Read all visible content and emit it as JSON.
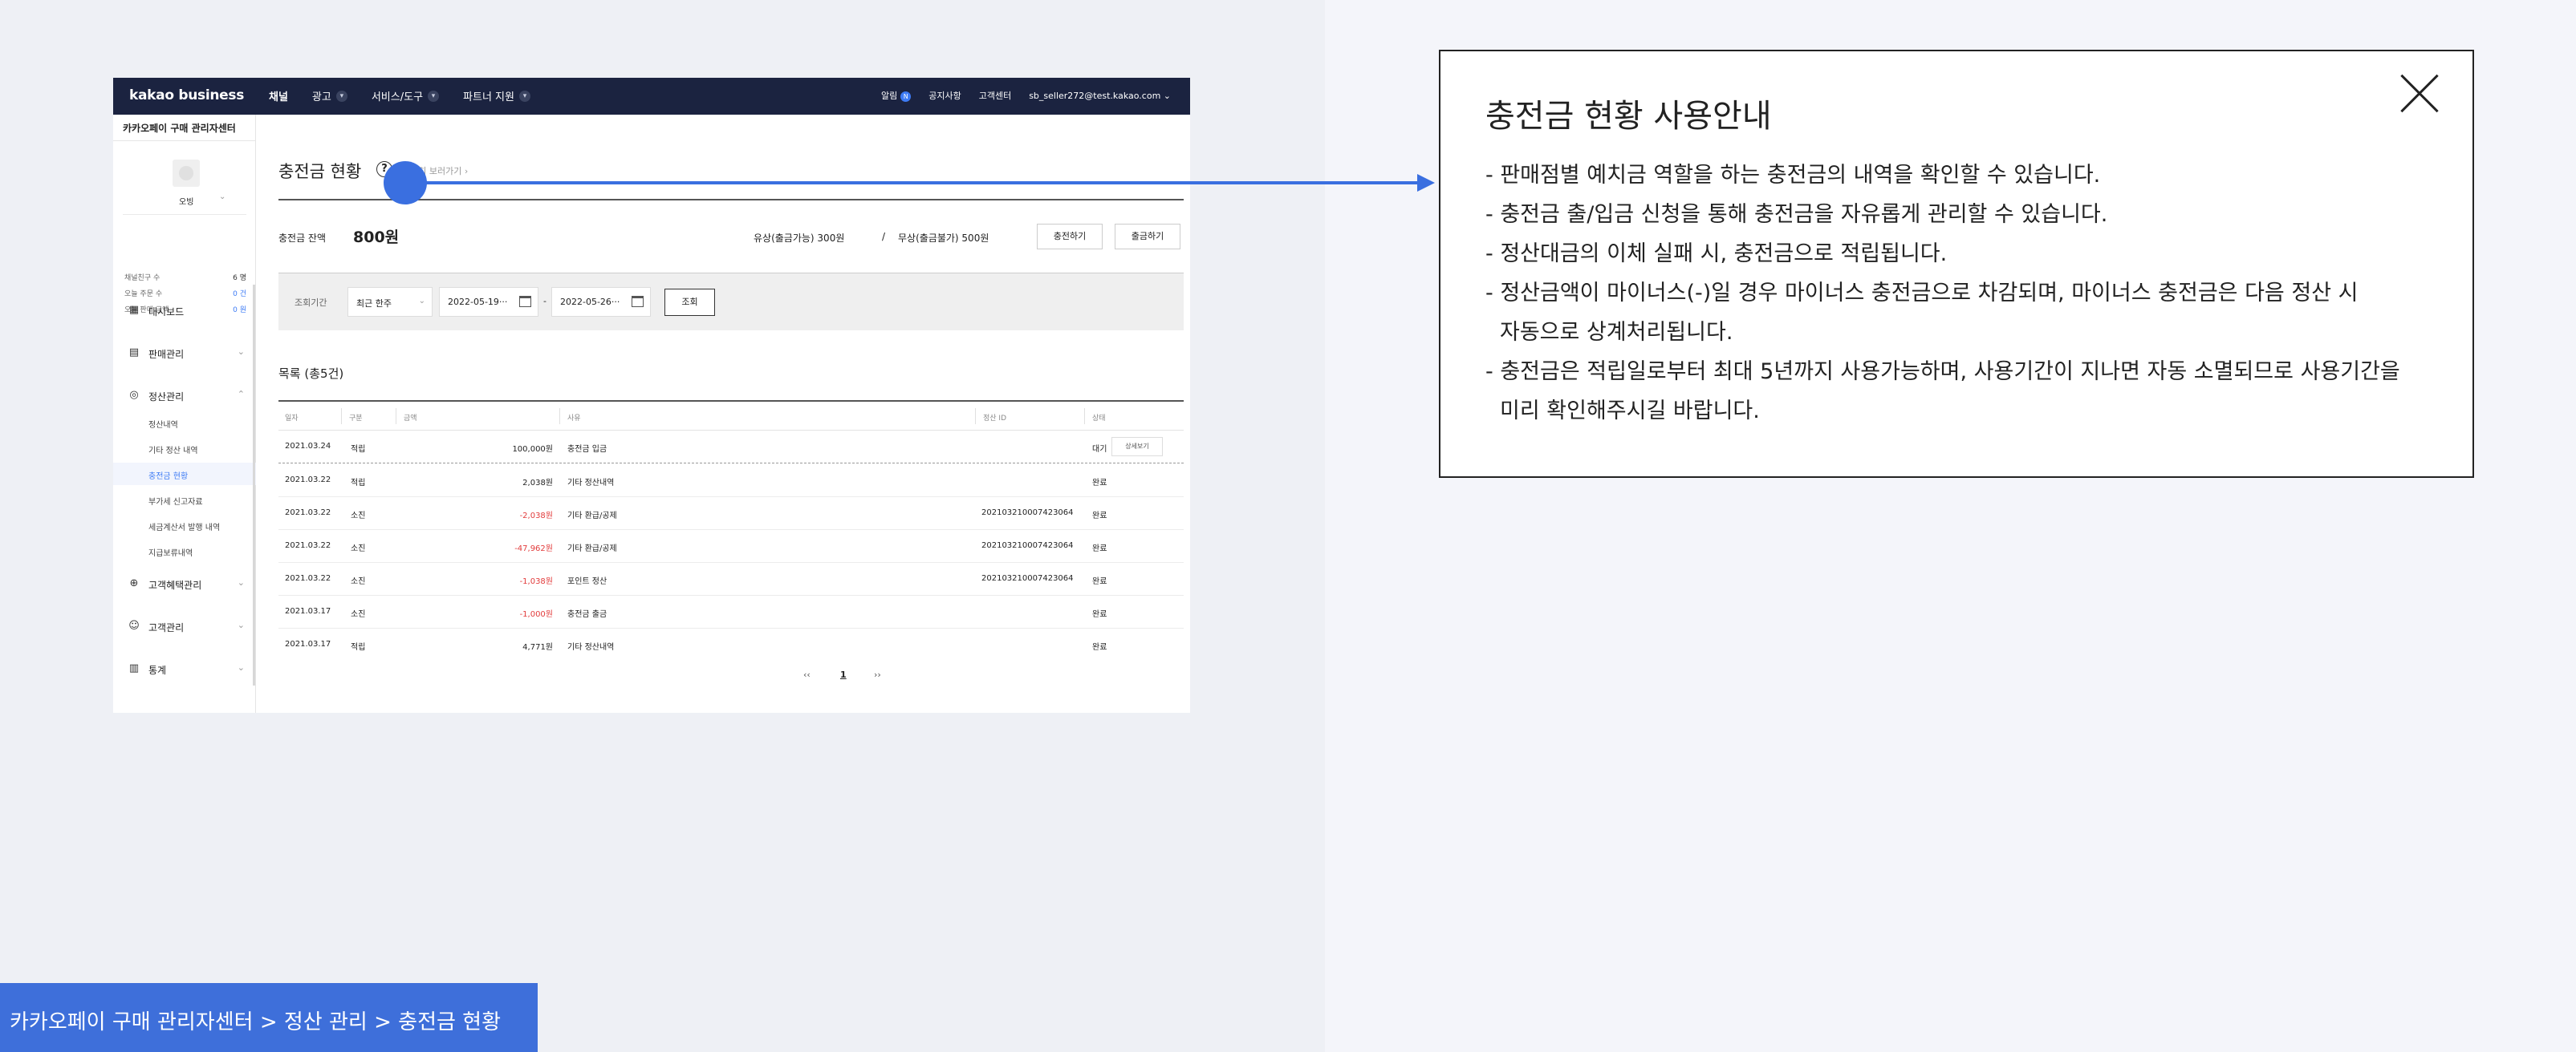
{
  "topbar": {
    "logo": "kakao business",
    "nav": [
      "채널",
      "광고",
      "서비스/도구",
      "파트너 지원"
    ],
    "alarm": "알림",
    "alarm_count": "N",
    "notice": "공지사항",
    "support": "고객센터",
    "account": "sb_seller272@test.kakao.com"
  },
  "sidebar": {
    "title": "카카오페이 구매 관리자센터",
    "profile_name": "오빙",
    "stats": [
      {
        "label": "채널친구 수",
        "value": "6 명"
      },
      {
        "label": "오늘 주문 수",
        "value": "0 건"
      },
      {
        "label": "오늘 판매 금액",
        "value": "0 원"
      }
    ],
    "menus": {
      "dashboard": "대시보드",
      "sales": "판매관리",
      "settlement": "정산관리",
      "benefit": "고객혜택관리",
      "customer": "고객관리",
      "stats": "통계"
    },
    "submenus": [
      "정산내역",
      "기타 정산 내역",
      "충전금 현황",
      "부가세 신고자료",
      "세금계산서 발행 내역",
      "지급보류내역"
    ]
  },
  "main": {
    "title": "충전금 현황",
    "help": "?",
    "detail_link": "자세히 보러가기 ›",
    "balance_label": "충전금 잔액",
    "balance_value": "800원",
    "paid": "유상(출금가능)    300원",
    "sep": "/",
    "free": "무상(출금불가)    500원",
    "charge_btn": "충전하기",
    "withdraw_btn": "출금하기",
    "search": {
      "label": "조회기간",
      "period": "최근 한주",
      "start": "2022-05-19···",
      "dash": "-",
      "end": "2022-05-26···",
      "button": "조회"
    },
    "list_title": "목록 (총5건)",
    "columns": [
      "일자",
      "구분",
      "금액",
      "사유",
      "정산 ID",
      "상태"
    ],
    "rows": [
      {
        "date": "2021.03.24",
        "type": "적립",
        "amount": "100,000원",
        "reason": "충전금 입금",
        "id": "",
        "status": "대기",
        "action": "상세보기"
      },
      {
        "date": "2021.03.22",
        "type": "적립",
        "amount": "2,038원",
        "reason": "기타 정산내역",
        "id": "",
        "status": "완료"
      },
      {
        "date": "2021.03.22",
        "type": "소진",
        "amount": "-2,038원",
        "reason": "기타 환급/공제",
        "id": "20210321000742306​4",
        "status": "완료"
      },
      {
        "date": "2021.03.22",
        "type": "소진",
        "amount": "-47,962원",
        "reason": "기타 환급/공제",
        "id": "202103210007423064",
        "status": "완료"
      },
      {
        "date": "2021.03.22",
        "type": "소진",
        "amount": "-1,038원",
        "reason": "포인트 정산",
        "id": "202103210007423064",
        "status": "완료"
      },
      {
        "date": "2021.03.17",
        "type": "소진",
        "amount": "-1,000원",
        "reason": "충전금 출금",
        "id": "",
        "status": "완료"
      },
      {
        "date": "2021.03.17",
        "type": "적립",
        "amount": "4,771원",
        "reason": "기타 정산내역",
        "id": "",
        "status": "완료"
      }
    ],
    "pager": {
      "prev": "‹‹",
      "current": "1",
      "next": "››"
    }
  },
  "guide": {
    "title": "충전금 현황 사용안내",
    "lines": [
      "- 판매점별 예치금 역할을 하는 충전금의 내역을 확인할 수 있습니다.",
      "- 충전금 출/입금 신청을 통해 충전금을 자유롭게 관리할 수 있습니다.",
      "- 정산대금의 이체 실패 시, 충전금으로 적립됩니다.",
      "- 정산금액이 마이너스(-)일 경우 마이너스 충전금으로 차감되며, 마이너스 충전금은 다음 정산 시",
      "자동으로 상계처리됩니다.",
      "- 충전금은 적립일로부터 최대 5년까지 사용가능하며, 사용기간이 지나면 자동 소멸되므로 사용기간을",
      "미리 확인해주시길 바랍니다."
    ]
  },
  "breadcrumb": "카카오페이 구매 관리자센터 > 정산 관리 > 충전금 현황",
  "colors": {
    "navy": "#1b2340",
    "accent": "#3a6fe0",
    "negative": "#e23b3b",
    "link_active": "#3d7bf5"
  }
}
